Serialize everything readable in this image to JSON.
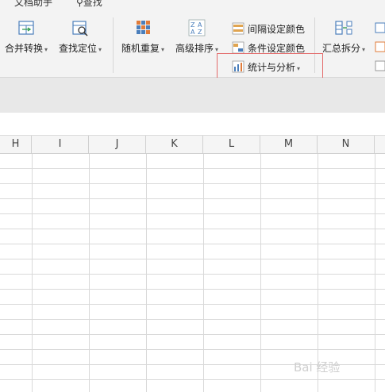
{
  "ribbon": {
    "top_items": [
      {
        "label": "文档助手"
      },
      {
        "label": "查找"
      }
    ],
    "big_buttons": [
      {
        "label": "合并转换",
        "icon": "merge-table-icon"
      },
      {
        "label": "查找定位",
        "icon": "find-locate-icon"
      },
      {
        "label": "随机重复",
        "icon": "random-repeat-icon"
      },
      {
        "label": "高级排序",
        "icon": "advanced-sort-icon"
      },
      {
        "label": "汇总拆分",
        "icon": "summary-split-icon"
      }
    ],
    "small_buttons": [
      {
        "label": "间隔设定颜色",
        "icon": "interval-color-icon"
      },
      {
        "label": "条件设定颜色",
        "icon": "condition-color-icon"
      },
      {
        "label": "统计与分析",
        "icon": "statistics-icon"
      }
    ],
    "caret": "▾"
  },
  "columns": [
    "H",
    "I",
    "J",
    "K",
    "L",
    "M",
    "N"
  ],
  "watermark": "Bai 经验",
  "colors": {
    "highlight": "#e36a6a",
    "ribbon_bg": "#f3f3f3",
    "grid_line": "#d9d9d9"
  }
}
